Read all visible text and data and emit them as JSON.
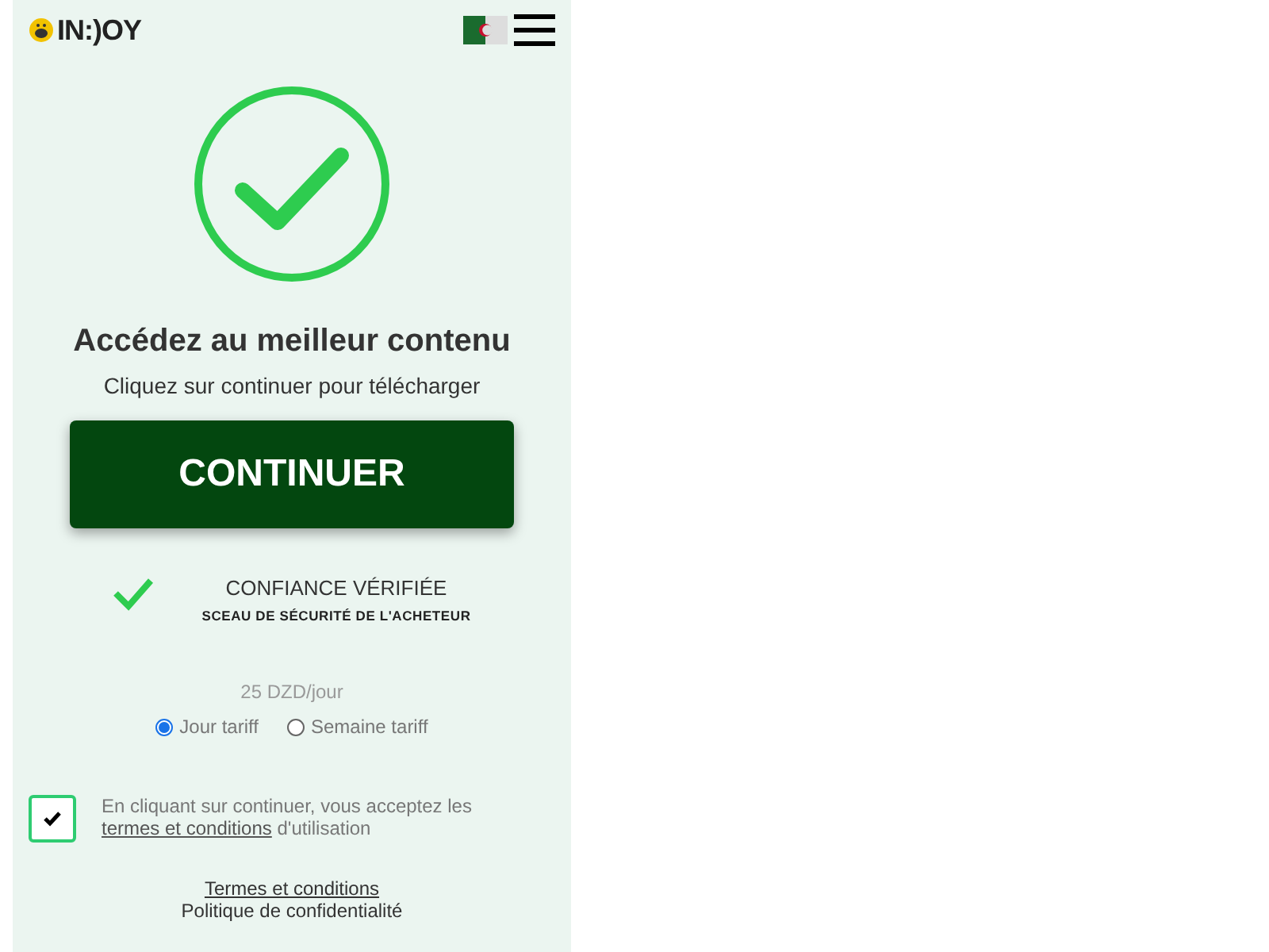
{
  "header": {
    "logo": "IN:)OY"
  },
  "status": {
    "title": "Accédez au meilleur contenu",
    "subtitle": "Cliquez sur continuer pour télécharger"
  },
  "continue_button": "CONTINUER",
  "trust": {
    "title": "CONFIANCE VÉRIFIÉE",
    "subtitle": "SCEAU DE SÉCURITÉ DE L'ACHETEUR"
  },
  "price": "25 DZD/jour",
  "tariffs": [
    {
      "label": "Jour tariff",
      "selected": true
    },
    {
      "label": "Semaine tariff",
      "selected": false
    }
  ],
  "consent": {
    "checked": true,
    "before": "En cliquant sur continuer, vous acceptez les",
    "link": "termes et conditions",
    "after": "d'utilisation"
  },
  "footer_links": [
    "Termes et conditions",
    "Politique de confidentialité"
  ]
}
